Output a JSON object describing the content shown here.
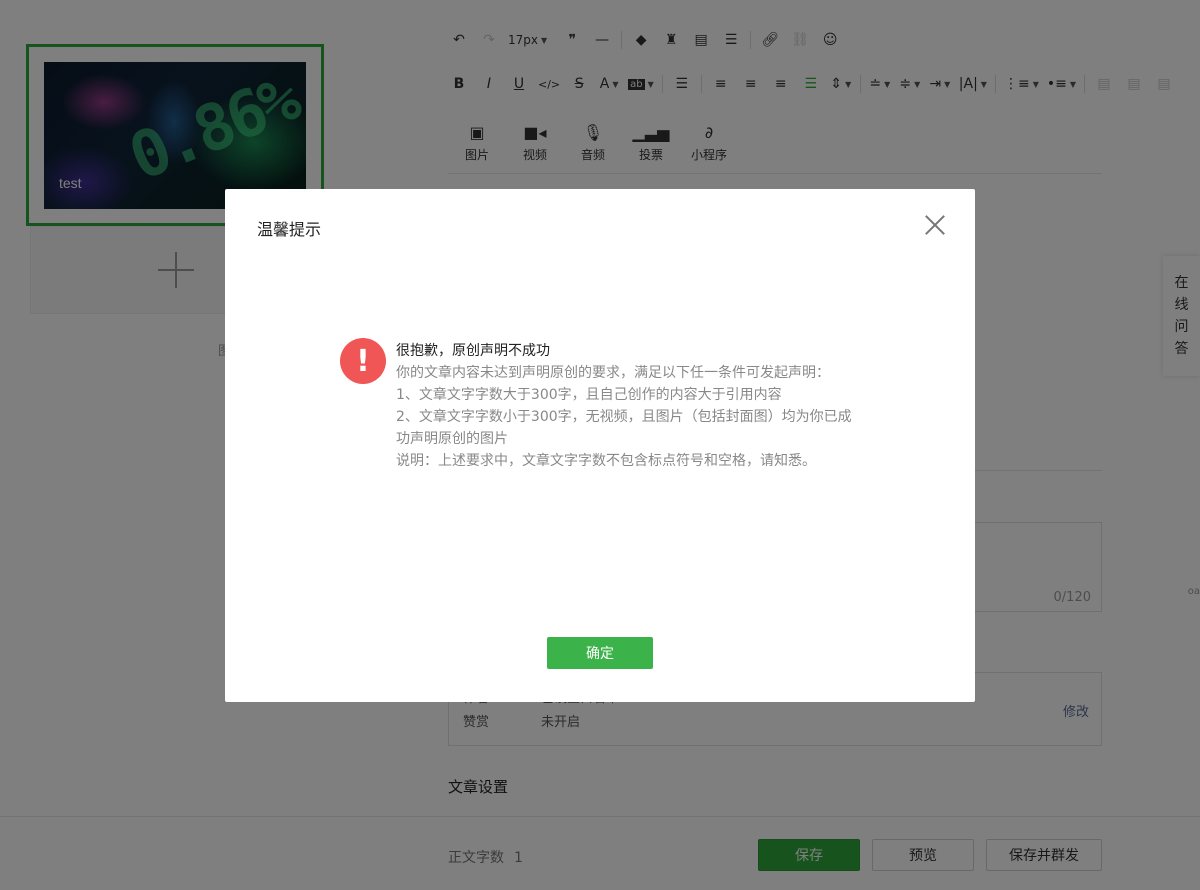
{
  "left_panel": {
    "article_title": "test",
    "thumbnail_text": "0.86%",
    "hint_text": "图"
  },
  "toolbar": {
    "font_size": "17px",
    "row1_icons": [
      "undo-icon",
      "redo-icon",
      "font-size-select",
      "quote-icon",
      "hr-icon",
      "eraser-icon",
      "format-painter-icon",
      "insert-template-icon",
      "template-icon",
      "link-icon",
      "unlink-icon",
      "emoji-icon"
    ],
    "row2_icons": [
      "bold-icon",
      "italic-icon",
      "underline-icon",
      "code-icon",
      "strikethrough-icon",
      "font-color-icon",
      "bg-color-icon",
      "indent-icon",
      "align-left-icon",
      "align-center-icon",
      "align-right-icon",
      "align-justify-icon",
      "line-spacing-icon",
      "paragraph-before-icon",
      "paragraph-after-icon",
      "text-indent-icon",
      "letter-spacing-icon",
      "ordered-list-icon",
      "unordered-list-icon",
      "table-left-icon",
      "table-center-icon",
      "table-right-icon"
    ],
    "accent_color": "#2fa83a"
  },
  "media": {
    "items": [
      {
        "icon": "image-icon",
        "label": "图片"
      },
      {
        "icon": "video-icon",
        "label": "视频"
      },
      {
        "icon": "audio-icon",
        "label": "音频"
      },
      {
        "icon": "vote-icon",
        "label": "投票"
      },
      {
        "icon": "mini-program-icon",
        "label": "小程序"
      }
    ]
  },
  "digest": {
    "count": "0/120"
  },
  "settings": {
    "row_partial_label": "作者",
    "row_partial_value": "已设置白名单",
    "reward_label": "赞赏",
    "reward_value": "未开启",
    "edit_label": "修改"
  },
  "article_settings_title": "文章设置",
  "edge_text": "oa",
  "bottom": {
    "word_count_label": "正文字数",
    "word_count_value": "1",
    "save_label": "保存",
    "preview_label": "预览",
    "publish_label": "保存并群发"
  },
  "float_help": {
    "chars": [
      "在",
      "线",
      "问",
      "答"
    ]
  },
  "dialog": {
    "title": "温馨提示",
    "icon": "!",
    "message_title": "很抱歉，原创声明不成功",
    "lines": [
      "你的文章内容未达到声明原创的要求，满足以下任一条件可发起声明：",
      "1、文章文字字数大于300字，且自己创作的内容大于引用内容",
      "2、文章文字字数小于300字，无视频，且图片（包括封面图）均为你已成",
      "功声明原创的图片",
      "说明：上述要求中，文章文字字数不包含标点符号和空格，请知悉。"
    ],
    "ok_label": "确定",
    "ok_color": "#3cb34a",
    "warn_color": "#f05656"
  }
}
